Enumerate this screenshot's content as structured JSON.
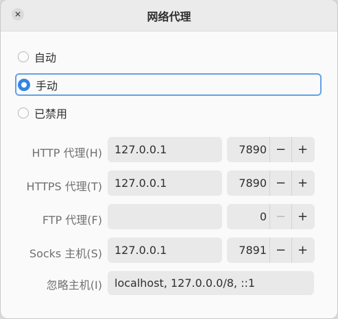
{
  "window": {
    "title": "网络代理"
  },
  "modes": [
    {
      "label": "自动",
      "selected": false
    },
    {
      "label": "手动",
      "selected": true
    },
    {
      "label": "已禁用",
      "selected": false
    }
  ],
  "proxies": {
    "http": {
      "label": "HTTP 代理(H)",
      "host": "127.0.0.1",
      "port": "7890"
    },
    "https": {
      "label": "HTTPS 代理(T)",
      "host": "127.0.0.1",
      "port": "7890"
    },
    "ftp": {
      "label": "FTP 代理(F)",
      "host": "",
      "port": "0"
    },
    "socks": {
      "label": "Socks 主机(S)",
      "host": "127.0.0.1",
      "port": "7891"
    }
  },
  "ignore": {
    "label": "忽略主机(I)",
    "value": "localhost, 127.0.0.0/8, ::1"
  },
  "glyphs": {
    "close": "✕",
    "minus": "−",
    "plus": "+"
  },
  "colors": {
    "accent": "#3584e4",
    "focus_ring": "#62a0ea"
  }
}
